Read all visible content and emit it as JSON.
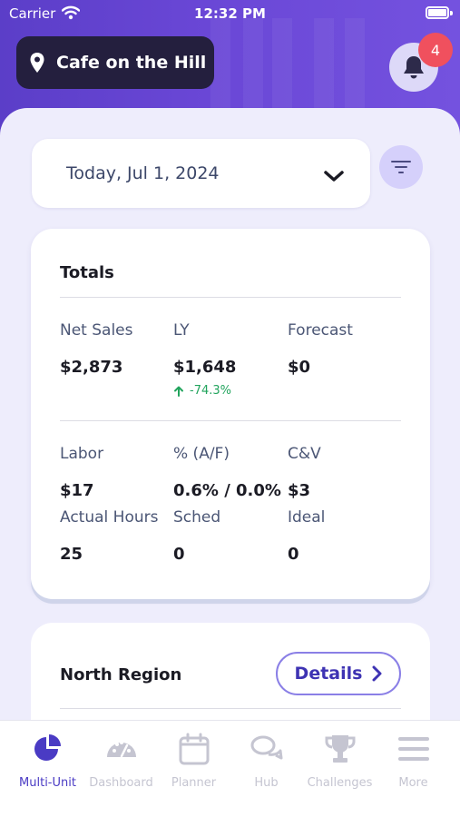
{
  "status_bar": {
    "carrier": "Carrier",
    "time": "12:32 PM"
  },
  "header": {
    "location_name": "Cafe on the Hill",
    "notification_count": "4"
  },
  "date_filter": {
    "selected": "Today, Jul 1, 2024"
  },
  "totals": {
    "title": "Totals",
    "net_sales": {
      "label": "Net Sales",
      "value": "$2,873"
    },
    "ly": {
      "label": "LY",
      "value": "$1,648",
      "change": "-74.3%"
    },
    "forecast": {
      "label": "Forecast",
      "value": "$0"
    },
    "labor": {
      "label": "Labor",
      "value": "$17"
    },
    "pct": {
      "label": "% (A/F)",
      "value": "0.6% / 0.0%"
    },
    "cv": {
      "label": "C&V",
      "value": "$3"
    },
    "actual_hours": {
      "label": "Actual Hours",
      "value": "25"
    },
    "sched": {
      "label": "Sched",
      "value": "0"
    },
    "ideal": {
      "label": "Ideal",
      "value": "0"
    }
  },
  "region": {
    "title": "North Region",
    "details_label": "Details"
  },
  "tabs": [
    {
      "label": "Multi-Unit",
      "icon": "pie-chart-icon",
      "active": true
    },
    {
      "label": "Dashboard",
      "icon": "gauge-icon",
      "active": false
    },
    {
      "label": "Planner",
      "icon": "calendar-icon",
      "active": false
    },
    {
      "label": "Hub",
      "icon": "chat-bubbles-icon",
      "active": false
    },
    {
      "label": "Challenges",
      "icon": "trophy-icon",
      "active": false
    },
    {
      "label": "More",
      "icon": "hamburger-menu-icon",
      "active": false
    }
  ],
  "colors": {
    "brand_purple": "#5b3ec8",
    "location_pill": "#241f3e",
    "badge_red": "#f0505e",
    "positive_green": "#22a45d",
    "active_tab": "#4a3bc4",
    "inactive_tab": "#c5c5d1"
  }
}
